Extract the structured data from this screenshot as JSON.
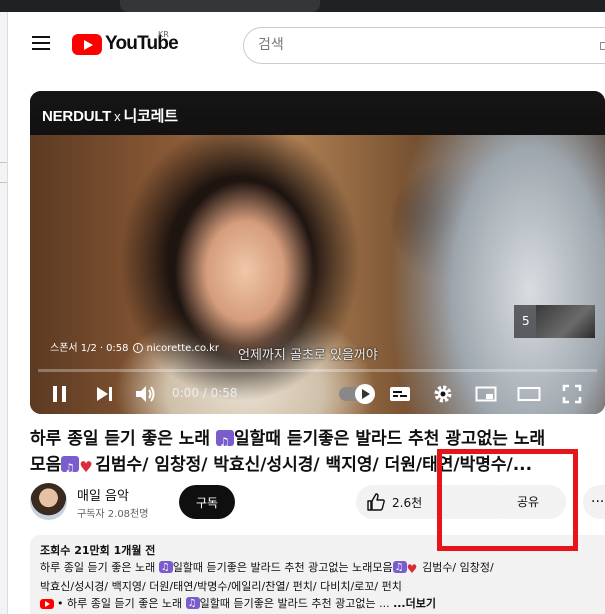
{
  "masthead": {
    "logo_text": "YouTube",
    "country_code": "KR",
    "search_placeholder": "검색"
  },
  "player": {
    "brand": "NERDULT",
    "brand_x": "x",
    "brand_partner": "니코레트",
    "caption": "언제까지 골초로 있을꺼야",
    "sponsor_label": "스폰서 1/2",
    "sponsor_time": "0:58",
    "sponsor_site": "nicorette.co.kr",
    "skip_count": "5",
    "time_display": "0:00 / 0:58",
    "progress_fraction": 0.0
  },
  "video": {
    "title_line1": "하루 종일 듣기 좋은 노래",
    "title_line1_b": "일할때 듣기좋은 발라드 추천 광고없는 노래",
    "title_line2_a": "모음",
    "title_line2_b": "김범수/ 임창정/ 박효신/성시경/ 백지영/ 더원/태연/박명수/..."
  },
  "channel": {
    "name": "매일 음악",
    "subscribers": "구독자 2.08천명",
    "subscribe_label": "구독",
    "like_count": "2.6천",
    "share_label": "공유",
    "more_label": "···"
  },
  "description": {
    "meta": "조회수 21만회  1개월 전",
    "line1_a": "하루 종일 듣기 좋은 노래",
    "line1_b": "일할때 듣기좋은 발라드 추천 광고없는 노래모음",
    "line1_c": " 김범수/ 임창정/",
    "line2": "박효신/성시경/ 백지영/ 더원/태연/박명수/에일리/찬열/ 펀치/ 다비치/로꼬/ 펀치",
    "line3_a": "• 하루 종일 듣기 좋은 노래",
    "line3_b": "일할때 듣기좋은 발라드 추천 광고없는 ...",
    "more_link": "...더보기"
  },
  "colors": {
    "youtube_red": "#ff0000",
    "highlight_box": "#e8141c",
    "ad_progress": "#ffcc00"
  }
}
